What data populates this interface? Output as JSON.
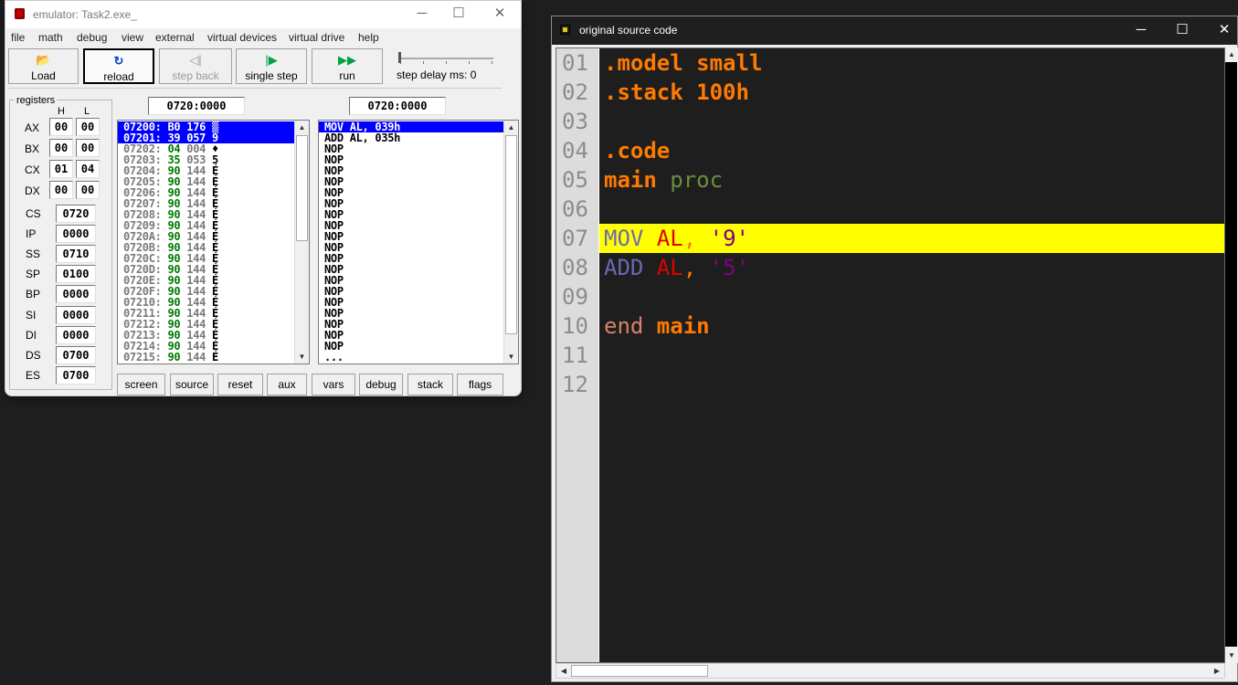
{
  "emulator": {
    "title": "emulator: Task2.exe_",
    "window_controls": {
      "minimize": "─",
      "maximize": "☐",
      "close": "✕"
    },
    "menu": [
      "file",
      "math",
      "debug",
      "view",
      "external",
      "virtual devices",
      "virtual drive",
      "help"
    ],
    "toolbar": {
      "load": "Load",
      "reload": "reload",
      "step_back": "step back",
      "single_step": "single step",
      "run": "run",
      "step_delay": "step delay ms: 0"
    },
    "registers": {
      "group_label": "registers",
      "h_label": "H",
      "l_label": "L",
      "split": [
        {
          "name": "AX",
          "h": "00",
          "l": "00"
        },
        {
          "name": "BX",
          "h": "00",
          "l": "00"
        },
        {
          "name": "CX",
          "h": "01",
          "l": "04"
        },
        {
          "name": "DX",
          "h": "00",
          "l": "00"
        }
      ],
      "full": [
        {
          "name": "CS",
          "value": "0720"
        },
        {
          "name": "IP",
          "value": "0000"
        },
        {
          "name": "SS",
          "value": "0710"
        },
        {
          "name": "SP",
          "value": "0100"
        },
        {
          "name": "BP",
          "value": "0000"
        },
        {
          "name": "SI",
          "value": "0000"
        },
        {
          "name": "DI",
          "value": "0000"
        },
        {
          "name": "DS",
          "value": "0700"
        },
        {
          "name": "ES",
          "value": "0700"
        }
      ]
    },
    "memory_address": "0720:0000",
    "disasm_address": "0720:0000",
    "memory_rows": [
      {
        "addr": "07200:",
        "hex": "B0",
        "dec": "176",
        "ch": "▒",
        "selected": true
      },
      {
        "addr": "07201:",
        "hex": "39",
        "dec": "057",
        "ch": "9",
        "selected": true
      },
      {
        "addr": "07202:",
        "hex": "04",
        "dec": "004",
        "ch": "♦",
        "selected": false
      },
      {
        "addr": "07203:",
        "hex": "35",
        "dec": "053",
        "ch": "5",
        "selected": false
      },
      {
        "addr": "07204:",
        "hex": "90",
        "dec": "144",
        "ch": "É",
        "selected": false
      },
      {
        "addr": "07205:",
        "hex": "90",
        "dec": "144",
        "ch": "É",
        "selected": false
      },
      {
        "addr": "07206:",
        "hex": "90",
        "dec": "144",
        "ch": "É",
        "selected": false
      },
      {
        "addr": "07207:",
        "hex": "90",
        "dec": "144",
        "ch": "É",
        "selected": false
      },
      {
        "addr": "07208:",
        "hex": "90",
        "dec": "144",
        "ch": "É",
        "selected": false
      },
      {
        "addr": "07209:",
        "hex": "90",
        "dec": "144",
        "ch": "É",
        "selected": false
      },
      {
        "addr": "0720A:",
        "hex": "90",
        "dec": "144",
        "ch": "É",
        "selected": false
      },
      {
        "addr": "0720B:",
        "hex": "90",
        "dec": "144",
        "ch": "É",
        "selected": false
      },
      {
        "addr": "0720C:",
        "hex": "90",
        "dec": "144",
        "ch": "É",
        "selected": false
      },
      {
        "addr": "0720D:",
        "hex": "90",
        "dec": "144",
        "ch": "É",
        "selected": false
      },
      {
        "addr": "0720E:",
        "hex": "90",
        "dec": "144",
        "ch": "É",
        "selected": false
      },
      {
        "addr": "0720F:",
        "hex": "90",
        "dec": "144",
        "ch": "É",
        "selected": false
      },
      {
        "addr": "07210:",
        "hex": "90",
        "dec": "144",
        "ch": "É",
        "selected": false
      },
      {
        "addr": "07211:",
        "hex": "90",
        "dec": "144",
        "ch": "É",
        "selected": false
      },
      {
        "addr": "07212:",
        "hex": "90",
        "dec": "144",
        "ch": "É",
        "selected": false
      },
      {
        "addr": "07213:",
        "hex": "90",
        "dec": "144",
        "ch": "É",
        "selected": false
      },
      {
        "addr": "07214:",
        "hex": "90",
        "dec": "144",
        "ch": "É",
        "selected": false
      },
      {
        "addr": "07215:",
        "hex": "90",
        "dec": "144",
        "ch": "É",
        "selected": false
      }
    ],
    "disasm_rows": [
      {
        "text": "MOV AL, 039h",
        "selected": true
      },
      {
        "text": "ADD AL, 035h",
        "selected": false
      },
      {
        "text": "NOP",
        "selected": false
      },
      {
        "text": "NOP",
        "selected": false
      },
      {
        "text": "NOP",
        "selected": false
      },
      {
        "text": "NOP",
        "selected": false
      },
      {
        "text": "NOP",
        "selected": false
      },
      {
        "text": "NOP",
        "selected": false
      },
      {
        "text": "NOP",
        "selected": false
      },
      {
        "text": "NOP",
        "selected": false
      },
      {
        "text": "NOP",
        "selected": false
      },
      {
        "text": "NOP",
        "selected": false
      },
      {
        "text": "NOP",
        "selected": false
      },
      {
        "text": "NOP",
        "selected": false
      },
      {
        "text": "NOP",
        "selected": false
      },
      {
        "text": "NOP",
        "selected": false
      },
      {
        "text": "NOP",
        "selected": false
      },
      {
        "text": "NOP",
        "selected": false
      },
      {
        "text": "NOP",
        "selected": false
      },
      {
        "text": "NOP",
        "selected": false
      },
      {
        "text": "NOP",
        "selected": false
      },
      {
        "text": "...",
        "selected": false
      }
    ],
    "bottom_buttons": [
      "screen",
      "source",
      "reset",
      "aux",
      "vars",
      "debug",
      "stack",
      "flags"
    ],
    "colors": {
      "selection": "#0000ff",
      "hex_value": "#007a00"
    }
  },
  "source_window": {
    "title": "original source code",
    "window_controls": {
      "minimize": "─",
      "maximize": "☐",
      "close": "✕"
    },
    "highlight_color": "#ffff00",
    "lines": [
      {
        "num": "01",
        "tokens": [
          {
            "t": ".model small",
            "c": "dir"
          }
        ]
      },
      {
        "num": "02",
        "tokens": [
          {
            "t": ".stack 100h",
            "c": "dir"
          }
        ]
      },
      {
        "num": "03",
        "tokens": []
      },
      {
        "num": "04",
        "tokens": [
          {
            "t": ".code",
            "c": "dir"
          }
        ]
      },
      {
        "num": "05",
        "tokens": [
          {
            "t": "main",
            "c": "dir"
          },
          {
            "t": " proc",
            "c": "proc"
          }
        ]
      },
      {
        "num": "06",
        "tokens": []
      },
      {
        "num": "07",
        "tokens": [
          {
            "t": "MOV",
            "c": "op"
          },
          {
            "t": " AL",
            "c": "reg"
          },
          {
            "t": ",",
            "c": "comma"
          },
          {
            "t": " '9'",
            "c": "str"
          }
        ],
        "highlighted": true
      },
      {
        "num": "08",
        "tokens": [
          {
            "t": "ADD",
            "c": "op"
          },
          {
            "t": " AL",
            "c": "reg"
          },
          {
            "t": ",",
            "c": "comma"
          },
          {
            "t": " '5'",
            "c": "str"
          }
        ]
      },
      {
        "num": "09",
        "tokens": []
      },
      {
        "num": "10",
        "tokens": [
          {
            "t": "end",
            "c": "end"
          },
          {
            "t": " main",
            "c": "dir"
          }
        ]
      },
      {
        "num": "11",
        "tokens": []
      },
      {
        "num": "12",
        "tokens": []
      }
    ]
  }
}
